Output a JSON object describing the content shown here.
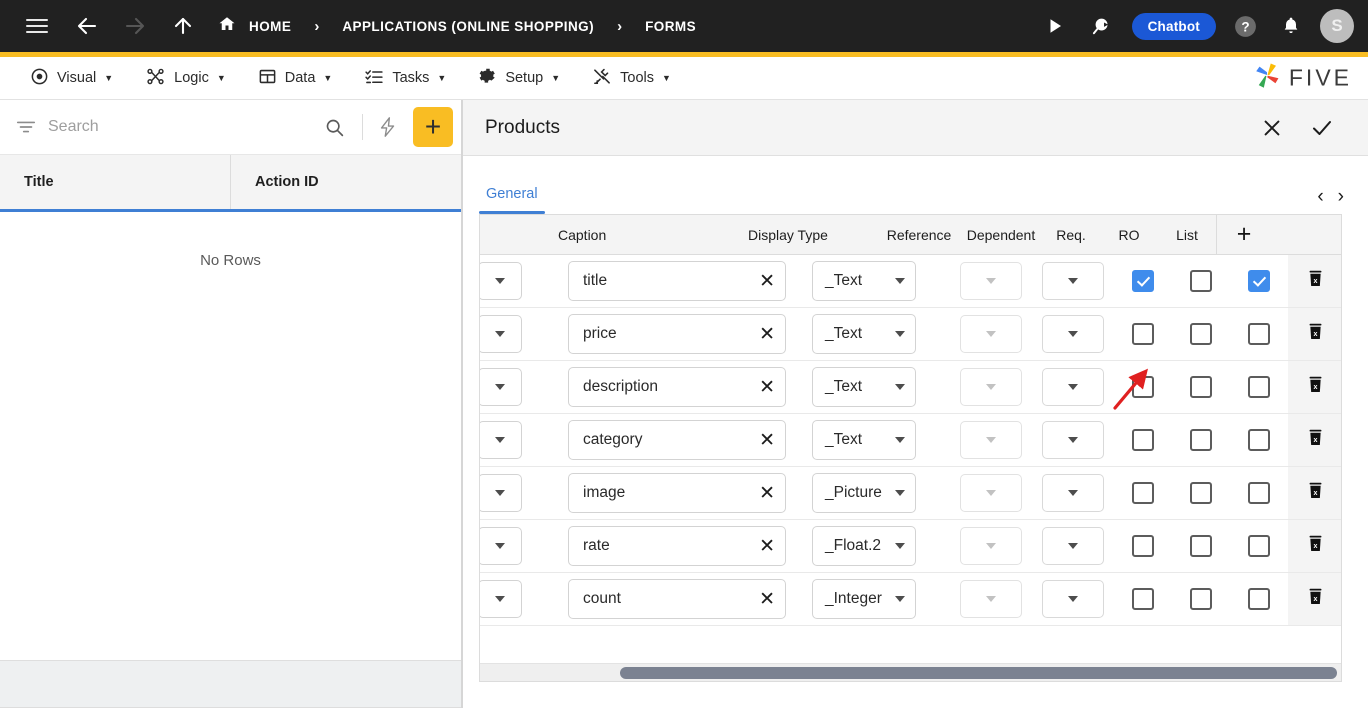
{
  "topbar": {
    "menu_icon": "hamburger-icon",
    "back_icon": "arrow-left-icon",
    "forward_icon": "arrow-right-icon",
    "up_icon": "arrow-up-icon",
    "home_icon": "home-icon",
    "breadcrumbs": [
      {
        "label": "HOME",
        "icon": "home-icon"
      },
      {
        "label": "APPLICATIONS (ONLINE SHOPPING)"
      },
      {
        "label": "FORMS"
      }
    ],
    "separator": "›",
    "run_icon": "play-icon",
    "search_icon": "search-speech-icon",
    "chatbot_label": "Chatbot",
    "help_icon": "help-circle-icon",
    "bell_icon": "bell-icon",
    "avatar_initial": "S",
    "bg_color": "#212121",
    "accent_color": "#f9bd23",
    "chatbot_color": "#1b58d6"
  },
  "menubar": {
    "items": [
      {
        "label": "Visual",
        "icon": "eye-icon",
        "caret": "▼"
      },
      {
        "label": "Logic",
        "icon": "logic-nodes-icon",
        "caret": "▼"
      },
      {
        "label": "Data",
        "icon": "table-icon",
        "caret": "▼"
      },
      {
        "label": "Tasks",
        "icon": "checklist-icon",
        "caret": "▼"
      },
      {
        "label": "Setup",
        "icon": "gear-icon",
        "caret": "▼"
      },
      {
        "label": "Tools",
        "icon": "tools-icon",
        "caret": "▼"
      }
    ],
    "logo_text": "FIVE",
    "logo_icon": "five-pinwheel-logo"
  },
  "left_panel": {
    "search": {
      "placeholder": "Search",
      "value": ""
    },
    "filter_icon": "filter-icon",
    "search_icon": "search-icon",
    "bolt_icon": "lightning-bolt-icon",
    "add_label": "+",
    "columns": [
      "Title",
      "Action ID"
    ],
    "rows": [],
    "empty_message": "No Rows"
  },
  "right_panel": {
    "title": "Products",
    "close_icon": "close-icon",
    "confirm_icon": "check-icon",
    "tabs": [
      {
        "label": "General",
        "active": true
      }
    ],
    "prev_icon": "‹",
    "next_icon": "›",
    "grid": {
      "columns": [
        "Caption",
        "Display Type",
        "Reference",
        "Dependent",
        "Req.",
        "RO",
        "List"
      ],
      "add_column_label": "+",
      "delete_icon": "trash-delete-icon",
      "clear_icon": "clear-x-icon",
      "rows": [
        {
          "caption": "title",
          "display_type": "_Text",
          "reference": "",
          "dependent": "",
          "req": true,
          "ro": false,
          "list": true
        },
        {
          "caption": "price",
          "display_type": "_Text",
          "reference": "",
          "dependent": "",
          "req": false,
          "ro": false,
          "list": false
        },
        {
          "caption": "description",
          "display_type": "_Text",
          "reference": "",
          "dependent": "",
          "req": false,
          "ro": false,
          "list": false
        },
        {
          "caption": "category",
          "display_type": "_Text",
          "reference": "",
          "dependent": "",
          "req": false,
          "ro": false,
          "list": false
        },
        {
          "caption": "image",
          "display_type": "_Picture",
          "reference": "",
          "dependent": "",
          "req": false,
          "ro": false,
          "list": false
        },
        {
          "caption": "rate",
          "display_type": "_Float.2",
          "reference": "",
          "dependent": "",
          "req": false,
          "ro": false,
          "list": false
        },
        {
          "caption": "count",
          "display_type": "_Integer",
          "reference": "",
          "dependent": "",
          "req": false,
          "ro": false,
          "list": false
        }
      ]
    },
    "annotation": {
      "type": "red-arrow",
      "points_at": "req-checkbox-row-title",
      "color": "#e02020"
    }
  }
}
